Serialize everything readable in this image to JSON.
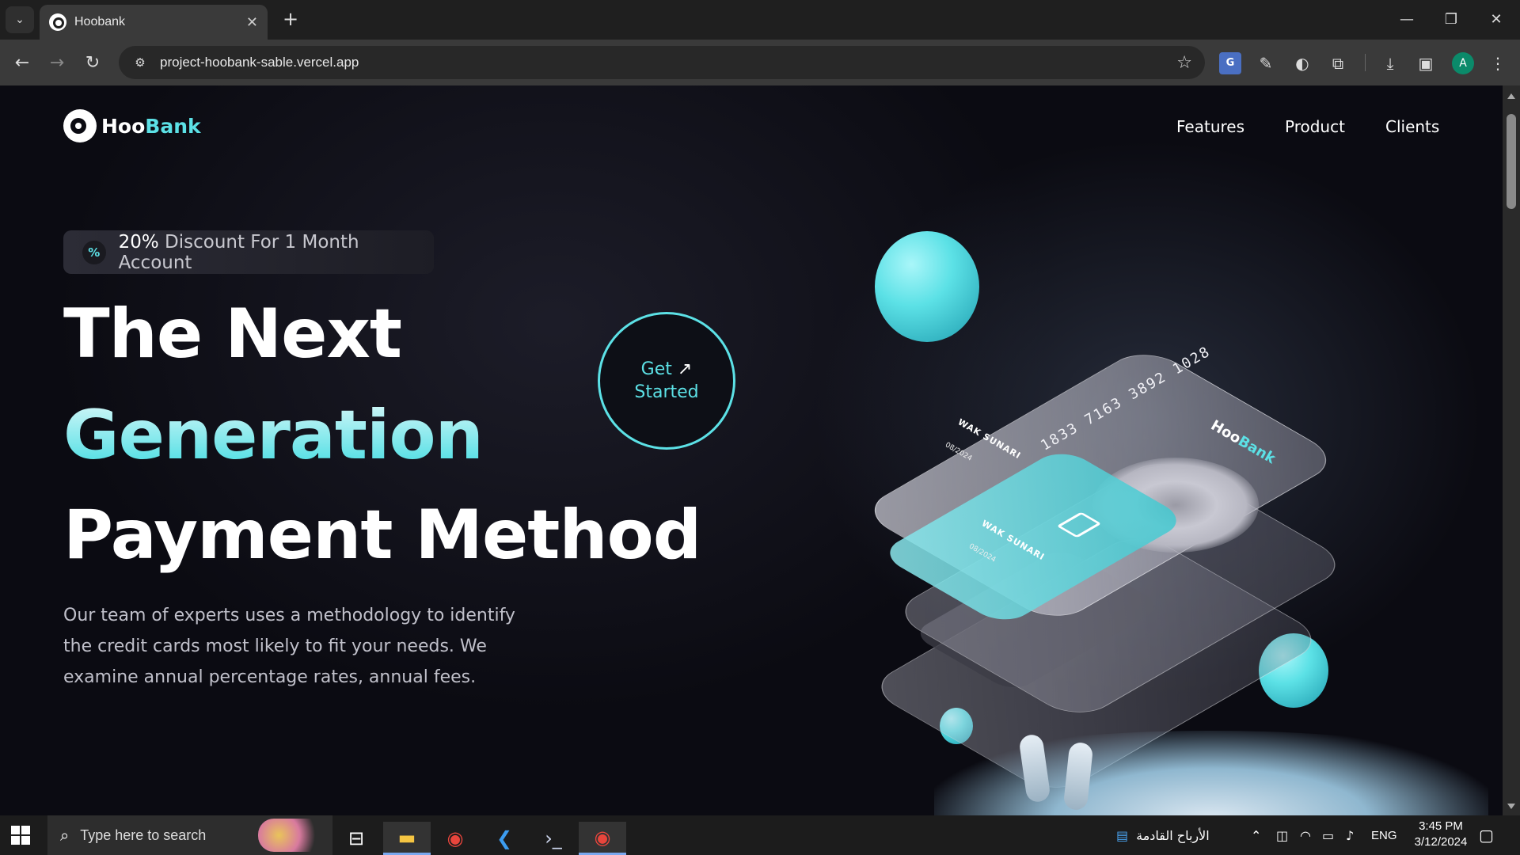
{
  "browser": {
    "tab_title": "Hoobank",
    "tab_close": "✕",
    "new_tab": "+",
    "url": "project-hoobank-sable.vercel.app",
    "window_controls": {
      "minimize": "—",
      "restore": "❐",
      "close": "✕"
    }
  },
  "page": {
    "logo": {
      "part1": "Hoo",
      "part2": "Bank"
    },
    "nav": [
      "Features",
      "Product",
      "Clients"
    ],
    "discount": {
      "highlight": "20%",
      "text": "Discount For 1 Month Account"
    },
    "heading": {
      "line1": "The Next",
      "line2": "Generation",
      "line3": "Payment Method"
    },
    "cta": {
      "line1": "Get",
      "line2": "Started",
      "arrow": "↗"
    },
    "description": "Our team of experts uses a methodology to identify the credit cards most likely to fit your needs. We examine annual percentage rates, annual fees.",
    "card": {
      "number": "1833 7163 3892 1028",
      "brand_part1": "Hoo",
      "brand_part2": "Bank",
      "holder": "WAK SUNARI",
      "expiry": "08/2024"
    },
    "colors": {
      "accent": "#5ce1e6",
      "background": "#0b0b12"
    }
  },
  "taskbar": {
    "search_placeholder": "Type here to search",
    "news_text": "الأرباح القادمة",
    "language": "ENG",
    "time": "3:45 PM",
    "date": "3/12/2024"
  }
}
